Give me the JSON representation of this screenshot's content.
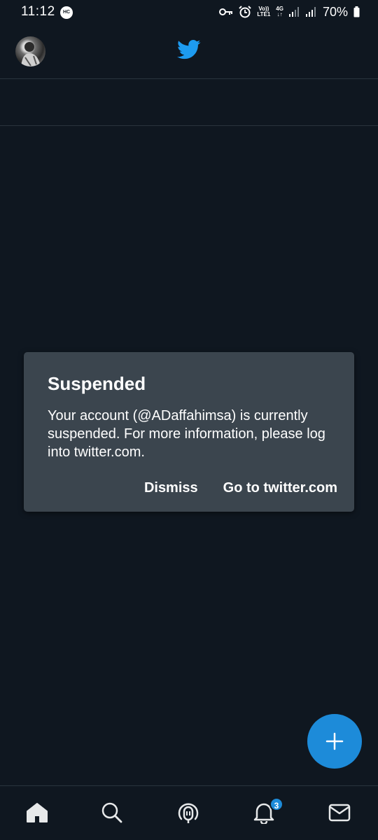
{
  "status_bar": {
    "time": "11:12",
    "hc_badge": "HC",
    "volte_label_top": "Vo))",
    "volte_label_bottom": "LTE1",
    "network": "4G",
    "battery": "70%"
  },
  "header": {
    "avatar_icon": "profile-avatar",
    "logo_icon": "twitter-bird-icon"
  },
  "dialog": {
    "title": "Suspended",
    "message": "Your account (@ADaffahimsa) is currently suspended. For more information, please log into twitter.com.",
    "dismiss_label": "Dismiss",
    "goto_label": "Go to twitter.com"
  },
  "fab": {
    "icon": "plus-icon"
  },
  "bottom_nav": {
    "items": [
      "home-icon",
      "search-icon",
      "spaces-icon",
      "notifications-icon",
      "messages-icon"
    ],
    "notifications_badge": "3"
  },
  "colors": {
    "background": "#0f1720",
    "dialog": "#3b454e",
    "accent": "#1d8bd9"
  }
}
